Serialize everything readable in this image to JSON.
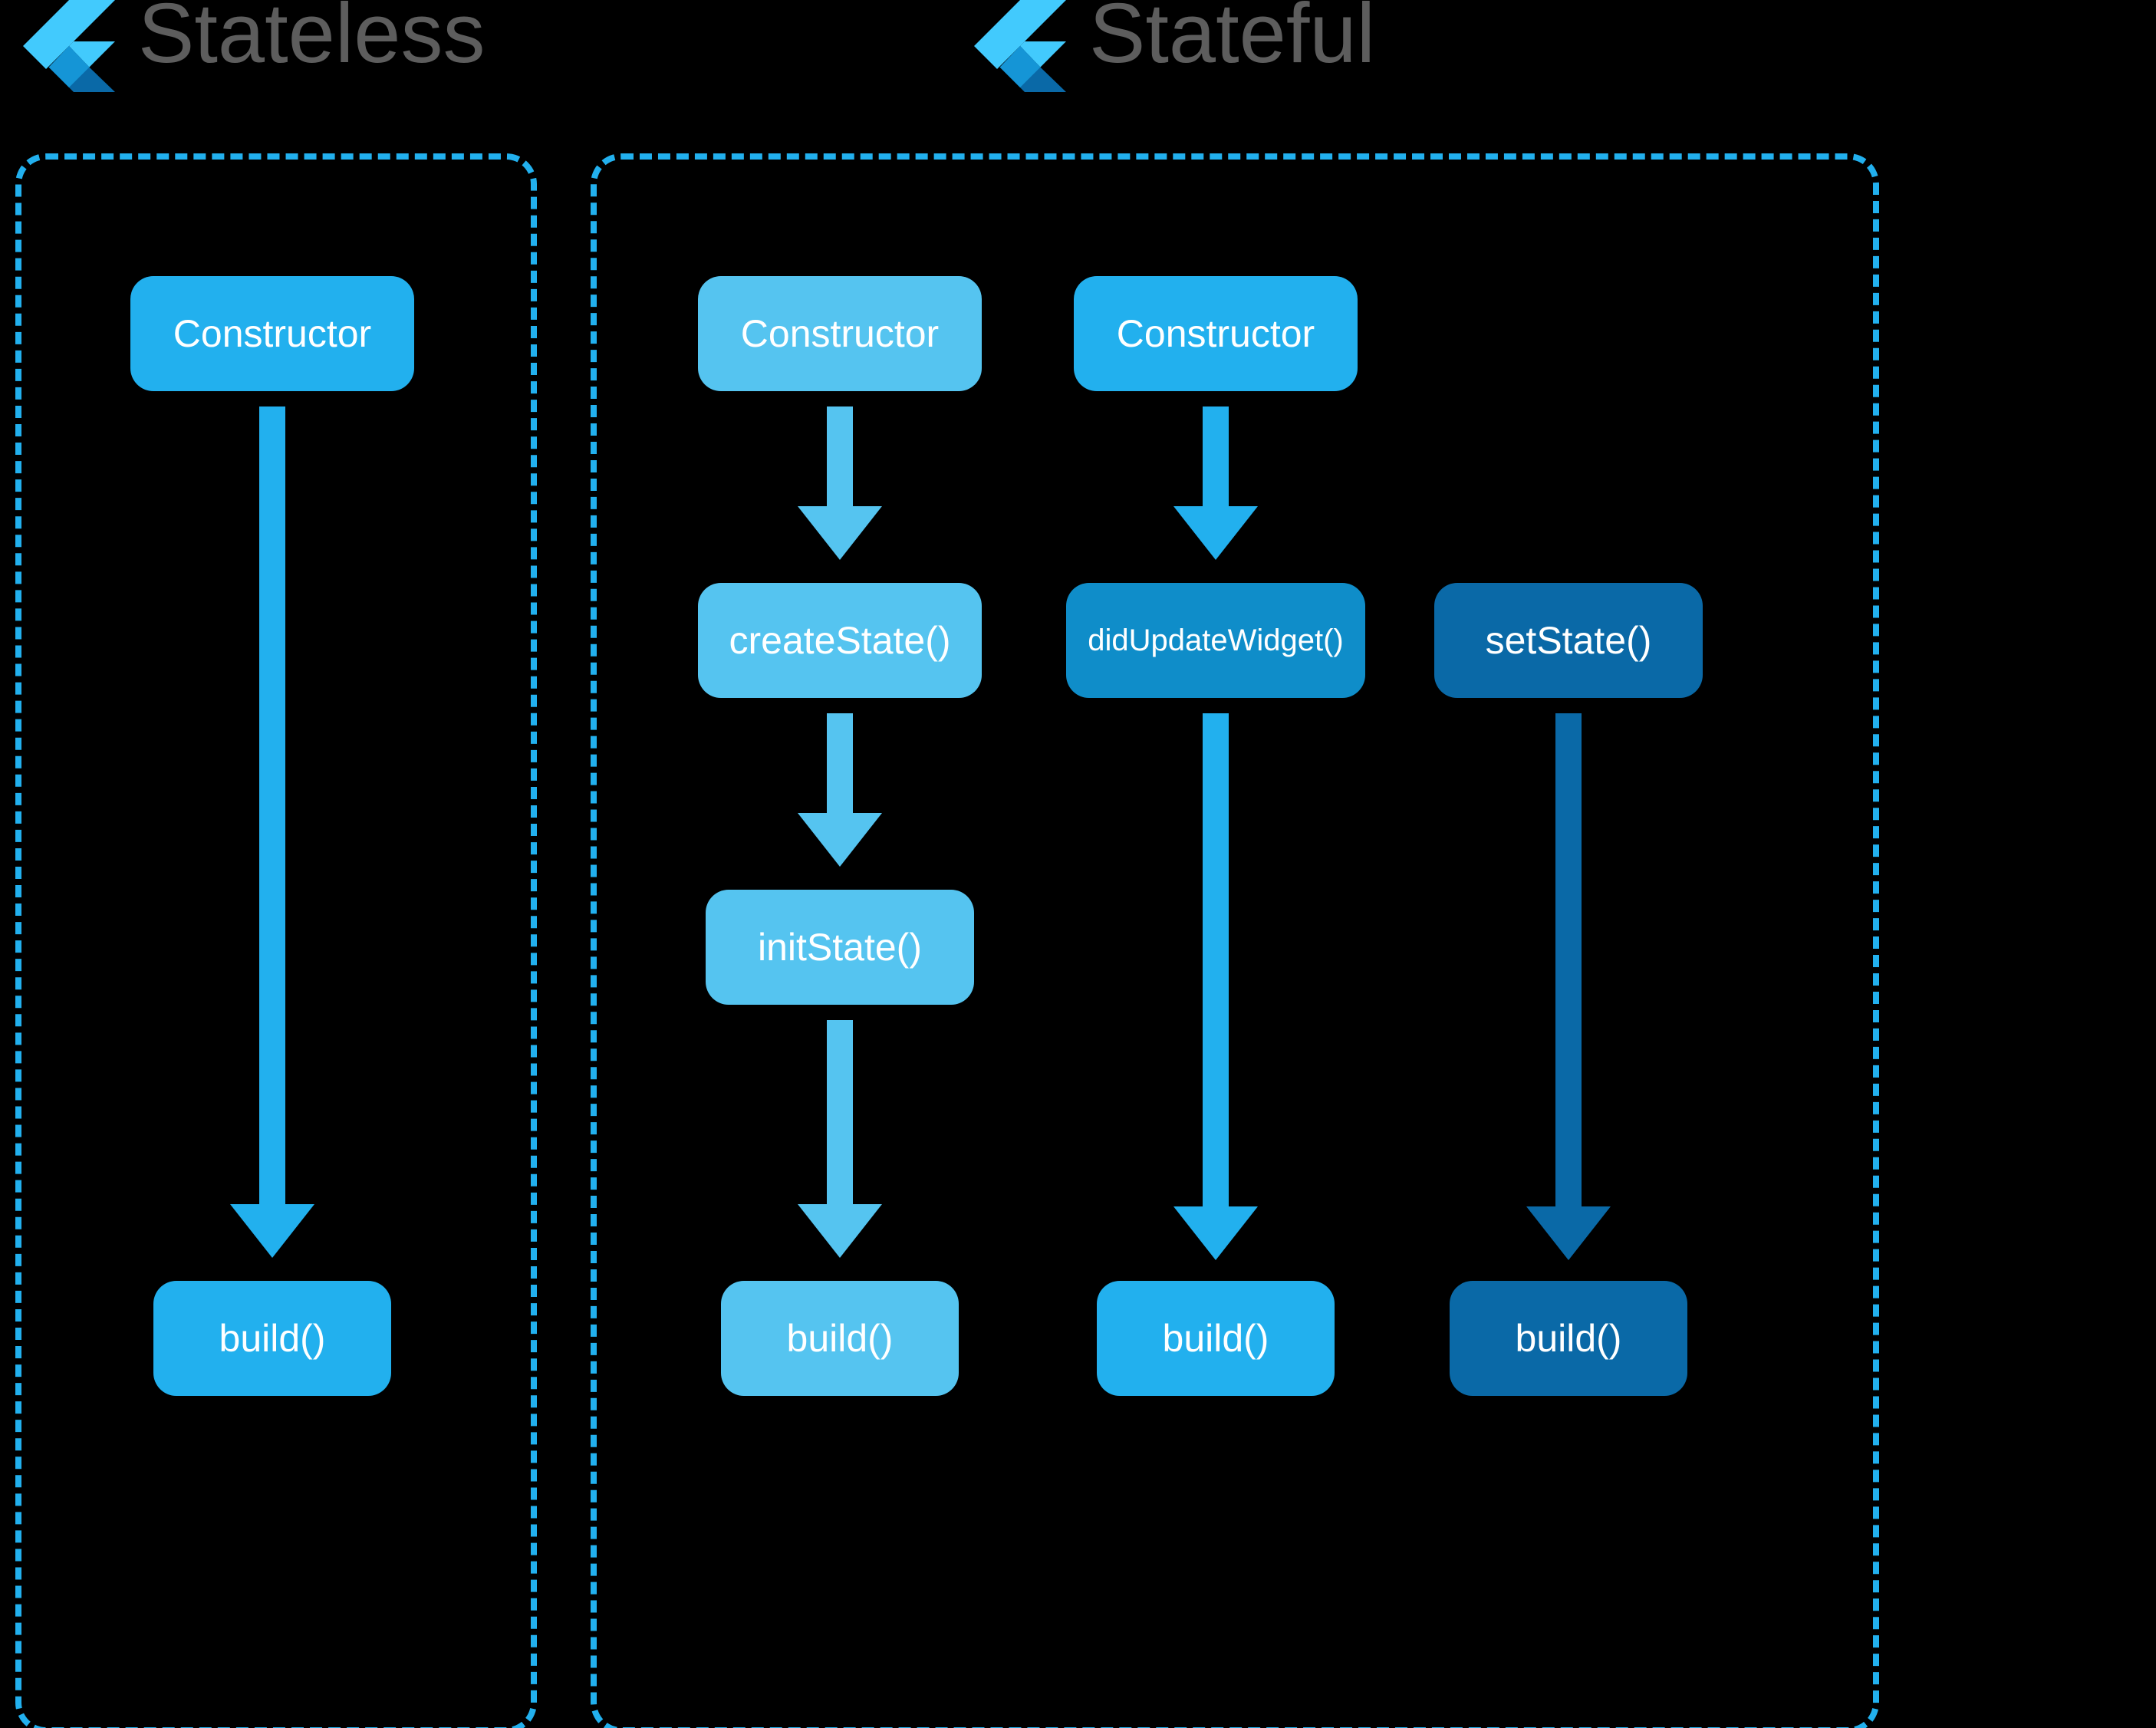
{
  "titles": {
    "stateless": "Stateless",
    "stateful": "Stateful"
  },
  "stateless": {
    "constructor": "Constructor",
    "build": "build()"
  },
  "stateful": {
    "col1": {
      "constructor": "Constructor",
      "createState": "createState()",
      "initState": "initState()",
      "build": "build()"
    },
    "col2": {
      "constructor": "Constructor",
      "didUpdateWidget": "didUpdateWidget()",
      "build": "build()"
    },
    "col3": {
      "setState": "setState()",
      "build": "build()"
    }
  },
  "colors": {
    "light": "#55c4f0",
    "mid": "#22b0ee",
    "mid2": "#0f8dc9",
    "dark": "#0a69a7",
    "panelBorder": "#22b0ee",
    "titleText": "#5d5d5d"
  },
  "chart_data": {
    "type": "table",
    "title": "Flutter Widget Lifecycle",
    "diagrams": [
      {
        "name": "Stateless",
        "flow": [
          "Constructor",
          "build()"
        ]
      },
      {
        "name": "Stateful",
        "flows": [
          [
            "Constructor",
            "createState()",
            "initState()",
            "build()"
          ],
          [
            "Constructor",
            "didUpdateWidget()",
            "build()"
          ],
          [
            "setState()",
            "build()"
          ]
        ]
      }
    ]
  }
}
